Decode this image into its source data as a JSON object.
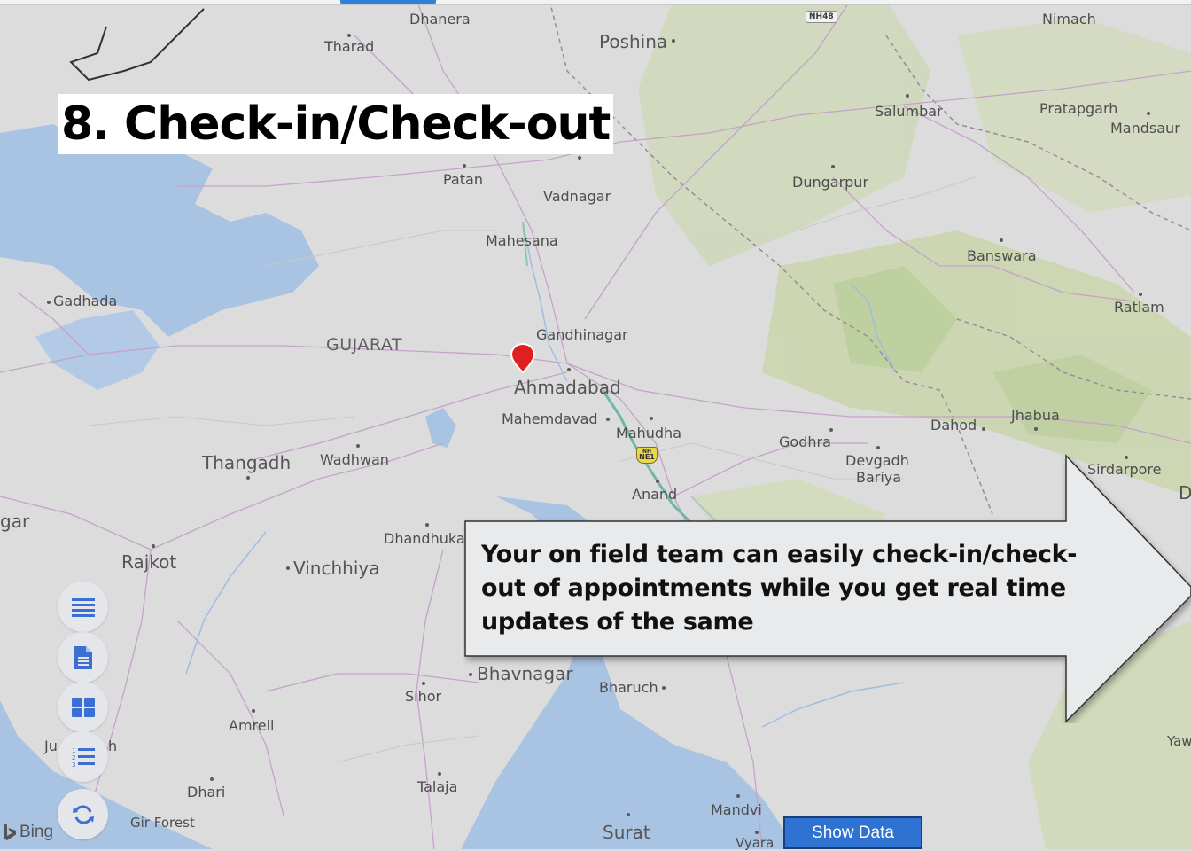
{
  "places": {
    "dhanera": "Dhanera",
    "tharad": "Tharad",
    "poshina": "Poshina",
    "nimach": "Nimach",
    "salumbar": "Salumbar",
    "pratapgarh": "Pratapgarh",
    "mandsaur": "Mandsaur",
    "patan": "Patan",
    "vadnagar": "Vadnagar",
    "dungarpur": "Dungarpur",
    "mahesana": "Mahesana",
    "banswara": "Banswara",
    "gadhada": "Gadhada",
    "ratlam": "Ratlam",
    "gujarat": "GUJARAT",
    "gandhinagar": "Gandhinagar",
    "ahmadabad": "Ahmadabad",
    "mahemdavad": "Mahemdavad",
    "mahudha": "Mahudha",
    "godhra": "Godhra",
    "dahod": "Dahod",
    "jhabua": "Jhabua",
    "devgadh": "Devgadh",
    "bariya": "Bariya",
    "thangadh": "Thangadh",
    "wadhwan": "Wadhwan",
    "anand": "Anand",
    "sirdarpore": "Sirdarpore",
    "gar": "gar",
    "dhandhuka": "Dhandhuka",
    "rajkot": "Rajkot",
    "vinchhiya": "Vinchhiya",
    "bhavnagar": "Bhavnagar",
    "bharuch": "Bharuch",
    "sihor": "Sihor",
    "amreli": "Amreli",
    "junagadh_a": "Ju",
    "junagadh_b": "h",
    "dhari": "Dhari",
    "talaja": "Talaja",
    "gir_forest": "Gir Forest",
    "mandvi": "Mandvi",
    "surat": "Surat",
    "vyara": "Vyara",
    "yaw": "Yaw",
    "d_edge": "D"
  },
  "road_shields": {
    "nh48": "NH48",
    "ne1_top": "NH",
    "ne1": "NE1"
  },
  "slide": {
    "title": "8. Check-in/Check-out",
    "callout_text": "Your on field team can easily check-in/check-out of appointments while you get real time updates of the same"
  },
  "controls": {
    "list_icon": "list-icon",
    "document_icon": "document-icon",
    "grid_icon": "grid-icon",
    "numbered_list_icon": "numbered-list-icon",
    "refresh_icon": "refresh-icon",
    "icon_color": "#3b6fd4"
  },
  "show_data_label": "Show Data",
  "attribution": "Bing",
  "colors": {
    "water": "#a9c3e3",
    "land": "#dcdcdc",
    "forest": "#c6d6a8",
    "marker": "#e02020",
    "button_blue": "#2e72d2"
  }
}
